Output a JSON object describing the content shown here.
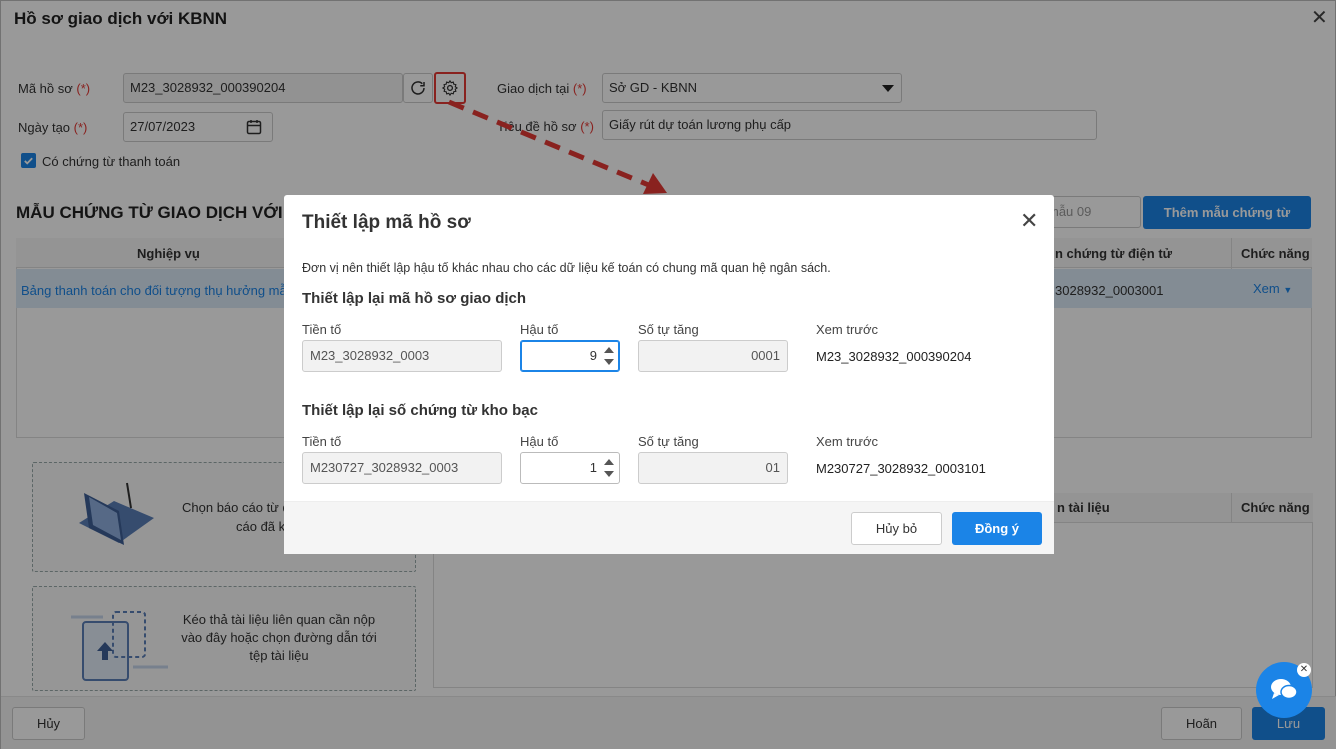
{
  "window": {
    "title": "Hồ sơ giao dịch với KBNN",
    "close_icon": "close-icon"
  },
  "form": {
    "ma_ho_so_label": "Mã hồ sơ",
    "ma_ho_so_value": "M23_3028932_000390204",
    "giao_dich_tai_label": "Giao dịch tại",
    "giao_dich_tai_value": "Sở GD - KBNN",
    "ngay_tao_label": "Ngày tạo",
    "ngay_tao_value": "27/07/2023",
    "tieu_de_label": "Tiêu đề hồ sơ",
    "tieu_de_value": "Giấy rút dự toán lương phụ cấp",
    "required_mark": "(*)",
    "checkbox_label": "Có chứng từ thanh toán",
    "checkbox_checked": true
  },
  "section": {
    "title": "MẪU CHỨNG TỪ GIAO DỊCH VỚI K",
    "search_placeholder": "mẫu 09",
    "add_button": "Thêm mẫu chứng từ"
  },
  "table1": {
    "headers": [
      "Nghiệp vụ",
      "n chứng từ điện tử",
      "Chức năng"
    ],
    "row": {
      "nghiep_vu": "Bảng thanh toán cho đối tượng thụ hưởng mẫ",
      "so_ct": "3028932_0003001",
      "action": "Xem"
    }
  },
  "table2": {
    "headers": [
      "n tài liệu",
      "Chức năng"
    ]
  },
  "dropzones": {
    "report_text_1": "Chọn báo cáo từ d",
    "report_text_2": "cáo đã k",
    "upload_text": "Kéo thả tài liệu liên quan cần nộp vào đây hoặc chọn đường dẫn tới tệp tài liệu"
  },
  "footer": {
    "cancel": "Hủy",
    "draft": "Hoãn",
    "save": "Lưu"
  },
  "dialog": {
    "title": "Thiết lập mã hồ sơ",
    "note": "Đơn vị nên thiết lập hậu tố khác nhau cho các dữ liệu kế toán có chung mã quan hệ ngân sách.",
    "section1": {
      "title": "Thiết lập lại mã hồ sơ giao dịch",
      "tien_to_label": "Tiền tố",
      "tien_to": "M23_3028932_0003",
      "hau_to_label": "Hậu tố",
      "hau_to": "9",
      "so_tu_tang_label": "Số tự tăng",
      "so_tu_tang": "0001",
      "xem_truoc_label": "Xem trước",
      "xem_truoc": "M23_3028932_000390204"
    },
    "section2": {
      "title": "Thiết lập lại số chứng từ kho bạc",
      "tien_to_label": "Tiền tố",
      "tien_to": "M230727_3028932_0003",
      "hau_to_label": "Hậu tố",
      "hau_to": "1",
      "so_tu_tang_label": "Số tự tăng",
      "so_tu_tang": "01",
      "xem_truoc_label": "Xem trước",
      "xem_truoc": "M230727_3028932_0003101"
    },
    "cancel": "Hủy bỏ",
    "ok": "Đồng ý"
  },
  "colors": {
    "accent": "#1b84e7",
    "required": "#e53935",
    "highlight": "#e53935",
    "link": "#1b84e7"
  }
}
